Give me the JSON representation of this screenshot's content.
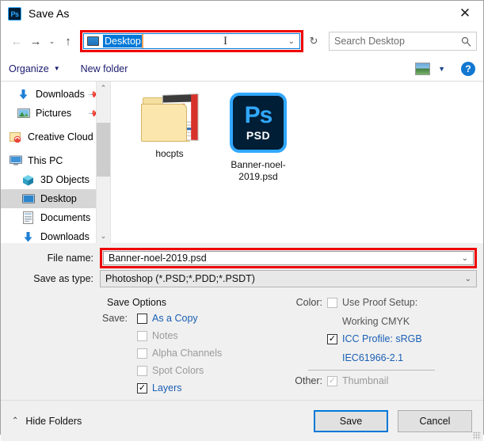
{
  "window": {
    "title": "Save As",
    "app_icon": "photoshop-icon",
    "close_label": "✕"
  },
  "nav": {
    "back_icon": "←",
    "forward_icon": "→",
    "history_icon": "⌄",
    "up_icon": "↑",
    "address_value": "Desktop",
    "address_chevron": "⌄",
    "refresh_icon": "↻",
    "search_placeholder": "Search Desktop",
    "search_icon": "⚲"
  },
  "commandbar": {
    "organize_label": "Organize",
    "organize_caret": "▼",
    "new_folder_label": "New folder",
    "view_caret": "▼",
    "help_label": "?"
  },
  "sidebar": {
    "items": [
      {
        "label": "Downloads",
        "icon": "download-arrow-icon",
        "pinned": true,
        "indent": 1,
        "selected": false
      },
      {
        "label": "Pictures",
        "icon": "pictures-icon",
        "pinned": true,
        "indent": 1,
        "selected": false
      },
      {
        "label": "Creative Cloud Fi",
        "icon": "creative-cloud-files-icon",
        "pinned": false,
        "indent": 0,
        "selected": false
      },
      {
        "label": "This PC",
        "icon": "this-pc-icon",
        "pinned": false,
        "indent": 0,
        "selected": false
      },
      {
        "label": "3D Objects",
        "icon": "3d-objects-icon",
        "pinned": false,
        "indent": 1,
        "selected": false
      },
      {
        "label": "Desktop",
        "icon": "desktop-icon",
        "pinned": false,
        "indent": 1,
        "selected": true
      },
      {
        "label": "Documents",
        "icon": "documents-icon",
        "pinned": false,
        "indent": 1,
        "selected": false
      },
      {
        "label": "Downloads",
        "icon": "download-arrow-icon",
        "pinned": false,
        "indent": 1,
        "selected": false
      }
    ],
    "scroll_up": "⌃",
    "scroll_down": "⌄"
  },
  "files": [
    {
      "name": "hocpts",
      "type": "folder"
    },
    {
      "name": "Banner-noel-2019.psd",
      "type": "psd",
      "badge": "Ps",
      "sub_badge": "PSD"
    }
  ],
  "fields": {
    "file_name_label": "File name:",
    "file_name_value": "Banner-noel-2019.psd",
    "save_as_type_label": "Save as type:",
    "save_as_type_value": "Photoshop (*.PSD;*.PDD;*.PSDT)",
    "chevron": "⌄"
  },
  "save_options": {
    "title": "Save Options",
    "save_key": "Save:",
    "items": [
      {
        "label": "As a Copy",
        "checked": false,
        "enabled": true
      },
      {
        "label": "Notes",
        "checked": false,
        "enabled": false
      },
      {
        "label": "Alpha Channels",
        "checked": false,
        "enabled": false
      },
      {
        "label": "Spot Colors",
        "checked": false,
        "enabled": false
      },
      {
        "label": "Layers",
        "checked": true,
        "enabled": true
      }
    ]
  },
  "color_options": {
    "color_key": "Color:",
    "proof_label": "Use Proof Setup:",
    "proof_sub": "Working CMYK",
    "proof_checked": false,
    "proof_enabled": false,
    "icc_label": "ICC Profile:  sRGB",
    "icc_sub": "IEC61966-2.1",
    "icc_checked": true,
    "other_key": "Other:",
    "thumbnail_label": "Thumbnail",
    "thumbnail_checked": true,
    "thumbnail_enabled": false
  },
  "footer": {
    "hide_folders_label": "Hide Folders",
    "hide_folders_caret": "⌃",
    "save_label": "Save",
    "cancel_label": "Cancel"
  },
  "colors": {
    "accent": "#0078d7",
    "highlight_box": "#ee0000",
    "link_blue": "#1a5fb4",
    "photoshop_blue": "#31a8ff",
    "photoshop_dark": "#001e36"
  }
}
